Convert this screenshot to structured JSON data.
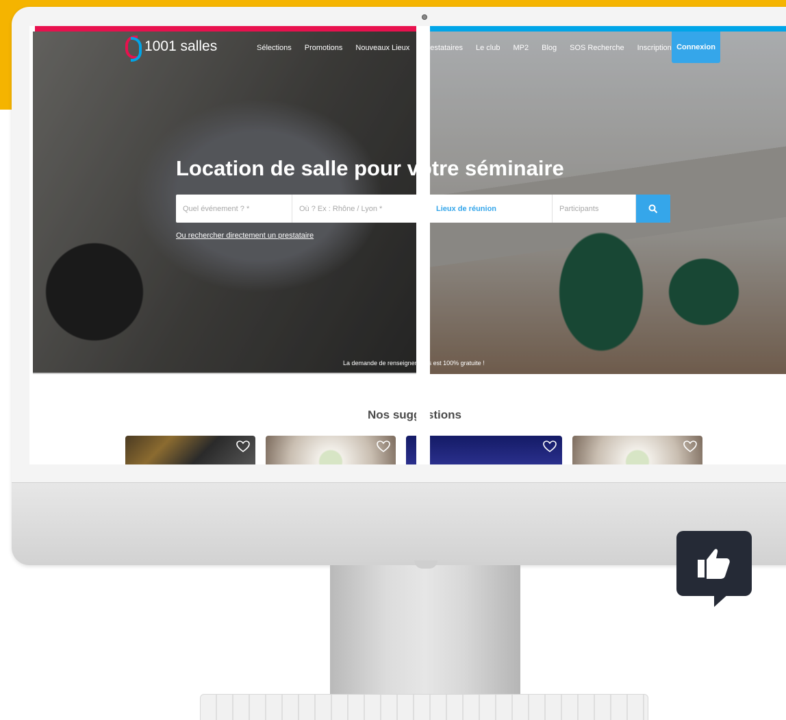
{
  "logo": {
    "text": "1001 salles"
  },
  "nav": {
    "items": [
      "Sélections",
      "Promotions",
      "Nouveaux Lieux",
      "Prestataires",
      "Le club",
      "MP2",
      "Blog",
      "SOS Recherche",
      "Inscription"
    ],
    "login_label": "Connexion"
  },
  "hero": {
    "title": "Location de salle pour votre séminaire",
    "search": {
      "event_placeholder": "Quel événement ? *",
      "where_placeholder": "Où ? Ex : Rhône / Lyon *",
      "type_value": "Lieux de réunion",
      "participants_placeholder": "Participants"
    },
    "provider_link": "Ou rechercher directement un prestataire",
    "free_note": "La demande de renseignements est 100% gratuite !"
  },
  "suggestions": {
    "title": "Nos suggestions",
    "cards": [
      {
        "id": "card-1"
      },
      {
        "id": "card-2"
      },
      {
        "id": "card-3"
      },
      {
        "id": "card-4"
      }
    ]
  },
  "colors": {
    "accent_blue": "#35a6ea",
    "brand_pink": "#e8114e",
    "brand_cyan": "#00a5e8",
    "background_yellow": "#f5b400",
    "badge_dark": "#252a36"
  },
  "icons": [
    "search-icon",
    "heart-icon",
    "thumbs-up-icon",
    "location-pin-icon"
  ]
}
